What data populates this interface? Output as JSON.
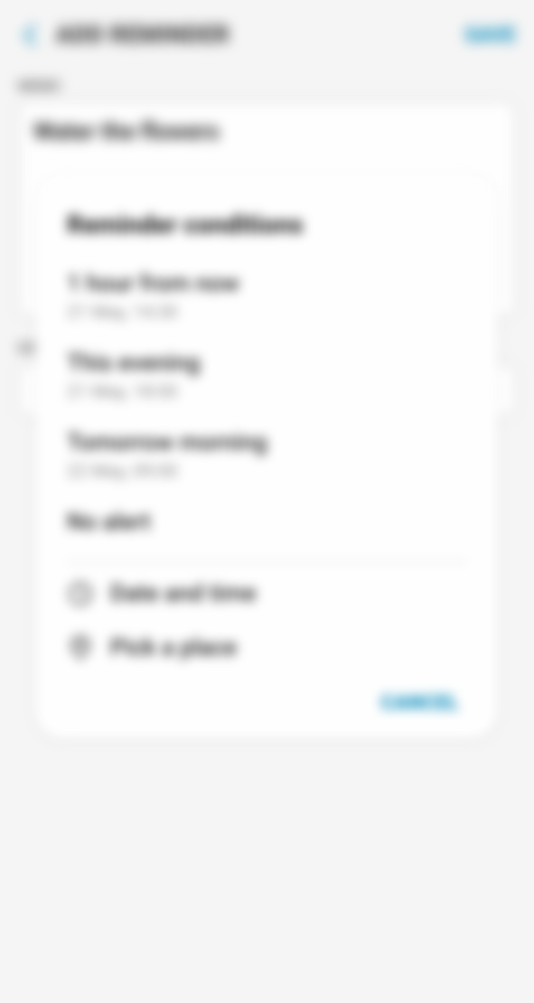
{
  "header": {
    "title": "ADD REMINDER",
    "save": "SAVE"
  },
  "memo": {
    "label": "MEMO",
    "value": "Water the flowers"
  },
  "date_section": {
    "label": "DATE"
  },
  "modal": {
    "title": "Reminder conditions",
    "options": [
      {
        "title": "1 hour from now",
        "sub": "21 May, 14:30"
      },
      {
        "title": "This evening",
        "sub": "21 May, 18:00"
      },
      {
        "title": "Tomorrow morning",
        "sub": "22 May, 09:00"
      }
    ],
    "no_alert": "No alert",
    "date_time": "Date and time",
    "pick_place": "Pick a place",
    "cancel": "CANCEL"
  }
}
